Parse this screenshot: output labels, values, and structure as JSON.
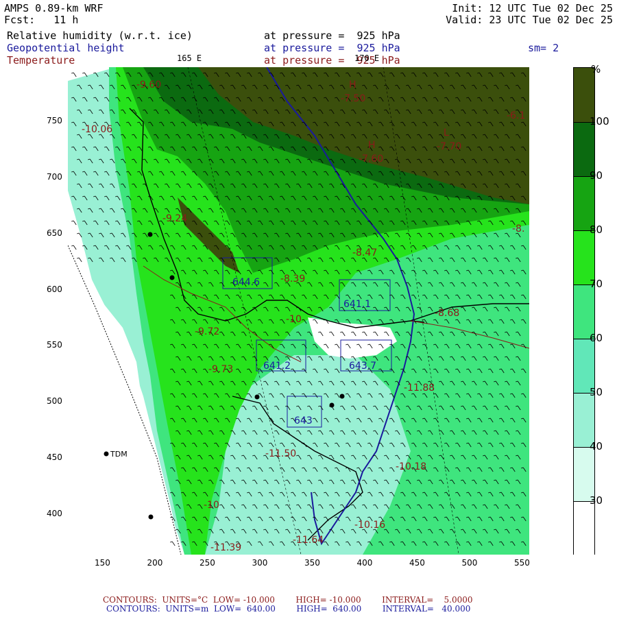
{
  "header": {
    "model": "AMPS 0.89-km WRF",
    "fcst": "Fcst:   11 h",
    "init": "Init: 12 UTC Tue 02 Dec 25",
    "valid": "Valid: 23 UTC Tue 02 Dec 25",
    "smoothing": "sm= 2"
  },
  "fields": [
    {
      "name": "Relative humidity (w.r.t. ice)",
      "level": "at pressure =  925 hPa",
      "color": "#000000"
    },
    {
      "name": "Geopotential height",
      "level": "at pressure =  925 hPa",
      "color": "#1a1a9c"
    },
    {
      "name": "Temperature",
      "level": "at pressure =  925 hPa",
      "color": "#8b1a1a"
    }
  ],
  "meridians": {
    "west": "165 E",
    "east": "170 E"
  },
  "colorbar": {
    "unit": "%",
    "labels": [
      "100",
      "90",
      "80",
      "70",
      "60",
      "50",
      "40",
      "30"
    ],
    "colors": [
      "#3b4f0c",
      "#0b6a10",
      "#16a412",
      "#26e31c",
      "#3fe57e",
      "#61e7b8",
      "#99f0d4",
      "#d7fbee",
      "#ffffff"
    ]
  },
  "x_ticks": [
    "150",
    "200",
    "250",
    "300",
    "350",
    "400",
    "450",
    "500",
    "550"
  ],
  "y_ticks": [
    "750",
    "700",
    "650",
    "600",
    "550",
    "500",
    "450",
    "400"
  ],
  "station": {
    "name": "TDM"
  },
  "map_labels": [
    {
      "text": "H",
      "kind": "temp"
    },
    {
      "text": "-7.50",
      "kind": "temp"
    },
    {
      "text": "H",
      "kind": "temp"
    },
    {
      "text": "-7.60",
      "kind": "temp"
    },
    {
      "text": "L",
      "kind": "temp"
    },
    {
      "text": "-7.70",
      "kind": "temp"
    },
    {
      "text": "-10.06",
      "kind": "temp"
    },
    {
      "text": "-9.24",
      "kind": "temp"
    },
    {
      "text": "-8.47",
      "kind": "temp"
    },
    {
      "text": "-8.39",
      "kind": "temp"
    },
    {
      "text": "-9.72",
      "kind": "temp"
    },
    {
      "text": "-9.73",
      "kind": "temp"
    },
    {
      "text": "-8.68",
      "kind": "temp"
    },
    {
      "text": "-11.88",
      "kind": "temp"
    },
    {
      "text": "-10.18",
      "kind": "temp"
    },
    {
      "text": "-10.16",
      "kind": "temp"
    },
    {
      "text": "-11.39",
      "kind": "temp"
    },
    {
      "text": "-11.64",
      "kind": "temp"
    },
    {
      "text": "-11.50",
      "kind": "temp"
    },
    {
      "text": "-10",
      "kind": "temp"
    },
    {
      "text": "-6.1",
      "kind": "temp"
    },
    {
      "text": "-8.",
      "kind": "temp"
    },
    {
      "text": "-9.60",
      "kind": "temp"
    },
    {
      "text": "-10",
      "kind": "temp"
    },
    {
      "text": "644.6",
      "kind": "height"
    },
    {
      "text": "641.1",
      "kind": "height"
    },
    {
      "text": "641.2",
      "kind": "height"
    },
    {
      "text": "643.7",
      "kind": "height"
    },
    {
      "text": "643",
      "kind": "height"
    }
  ],
  "footer": {
    "temp_line": "CONTOURS:  UNITS=°C  LOW= -10.000        HIGH= -10.000        INTERVAL=    5.0000",
    "height_line": "CONTOURS:  UNITS=m  LOW=  640.00        HIGH=  640.00        INTERVAL=   40.000"
  }
}
